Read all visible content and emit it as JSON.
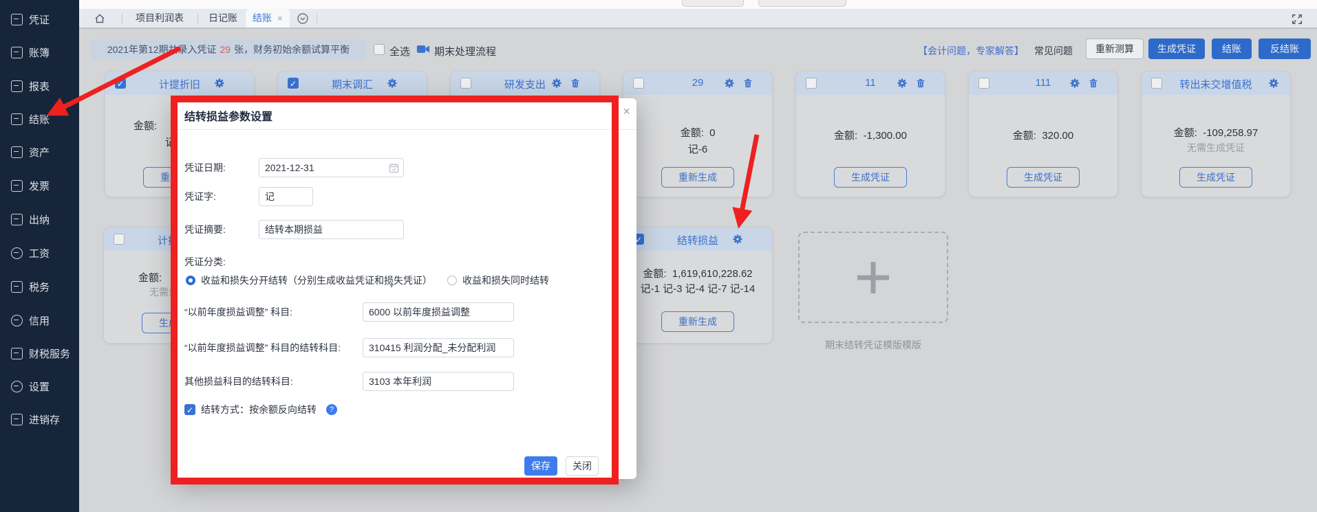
{
  "sidebar": {
    "items": [
      {
        "label": "凭证"
      },
      {
        "label": "账簿"
      },
      {
        "label": "报表"
      },
      {
        "label": "结账"
      },
      {
        "label": "资产"
      },
      {
        "label": "发票"
      },
      {
        "label": "出纳"
      },
      {
        "label": "工资"
      },
      {
        "label": "税务"
      },
      {
        "label": "信用"
      },
      {
        "label": "财税服务"
      },
      {
        "label": "设置"
      },
      {
        "label": "进销存"
      }
    ]
  },
  "tabbar": {
    "tabs": [
      {
        "label": "项目利润表"
      },
      {
        "label": "日记账"
      },
      {
        "label": "结账",
        "close": "×"
      }
    ]
  },
  "toolbar": {
    "summary_prefix": "2021年第12期共录入凭证",
    "summary_count": "29",
    "summary_suffix": "张，财务初始余额试算平衡",
    "select_all": "全选",
    "process_flow": "期末处理流程",
    "expert_link": "【会计问题，专家解答】",
    "faq": "常见问题",
    "recalculate": "重新测算",
    "generate_voucher": "生成凭证",
    "close_period": "结账",
    "reverse_close": "反结账"
  },
  "cards": {
    "amount_label": "金额:",
    "row1": [
      {
        "title": "计提折旧",
        "note": "记",
        "button": "重新生成"
      },
      {
        "title": "期末调汇"
      },
      {
        "title": "研发支出"
      },
      {
        "title": "29",
        "amount": "0",
        "note": "记-6",
        "button": "重新生成"
      },
      {
        "title": "11",
        "amount": "-1,300.00",
        "button": "生成凭证"
      },
      {
        "title": "111",
        "amount": "320.00",
        "button": "生成凭证"
      },
      {
        "title": "转出未交增值税",
        "amount": "-109,258.97",
        "gray_note": "无需生成凭证",
        "button": "生成凭证"
      }
    ],
    "row2": [
      {
        "title": "计提税金",
        "gray_note": "无需生成凭证",
        "button": "生成凭证"
      },
      {
        "title": "结转损益",
        "amount": "1,619,610,228.62",
        "refs": "记-1 记-3 记-4 记-7 记-14",
        "button": "重新生成"
      }
    ],
    "template_label": "期末结转凭证模版模版"
  },
  "modal": {
    "title": "结转损益参数设置",
    "close": "×",
    "fields": {
      "date_label": "凭证日期:",
      "date_value": "2021-12-31",
      "word_label": "凭证字:",
      "word_value": "记",
      "summary_label": "凭证摘要:",
      "summary_value": "结转本期损益",
      "category_label": "凭证分类:",
      "radio1": "收益和损失分开结转（分别生成收益凭证和损失凭证）",
      "radio2": "收益和损失同时结转",
      "prior_label": "“以前年度损益调整” 科目:",
      "prior_value": "6000 以前年度损益调整",
      "prior_transfer_label": "“以前年度损益调整” 科目的结转科目:",
      "prior_transfer_value": "310415 利润分配_未分配利润",
      "other_label": "其他损益科目的结转科目:",
      "other_value": "3103 本年利润",
      "method_label": "结转方式：按余额反向结转",
      "help": "?"
    },
    "save": "保存",
    "close_btn": "关闭"
  }
}
